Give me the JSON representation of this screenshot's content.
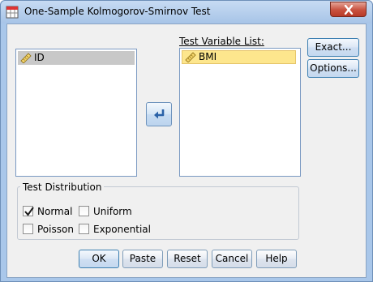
{
  "window": {
    "title": "One-Sample Kolmogorov-Smirnov Test",
    "icons": {
      "app": "spss-dialog-icon",
      "close": "close-icon"
    }
  },
  "source_list": {
    "items": [
      {
        "label": "ID",
        "icon": "ruler-scale-icon",
        "selected": true
      }
    ]
  },
  "move_button": {
    "icon": "arrow-move-icon"
  },
  "test_variable_list": {
    "label": "Test Variable List:",
    "items": [
      {
        "label": "BMI",
        "icon": "ruler-scale-icon",
        "selected": true
      }
    ]
  },
  "side_buttons": {
    "exact": "Exact...",
    "options": "Options..."
  },
  "test_distribution": {
    "legend": "Test Distribution",
    "options": {
      "normal": {
        "label": "Normal",
        "checked": true
      },
      "uniform": {
        "label": "Uniform",
        "checked": false
      },
      "poisson": {
        "label": "Poisson",
        "checked": false
      },
      "exponential": {
        "label": "Exponential",
        "checked": false
      }
    }
  },
  "footer_buttons": {
    "ok": "OK",
    "paste": "Paste",
    "reset": "Reset",
    "cancel": "Cancel",
    "help": "Help"
  },
  "colors": {
    "title_bar": "#a7c4e7",
    "dialog_bg": "#f0f0f0",
    "selected_target_item": "#fde68d",
    "close_button": "#c8513e"
  }
}
